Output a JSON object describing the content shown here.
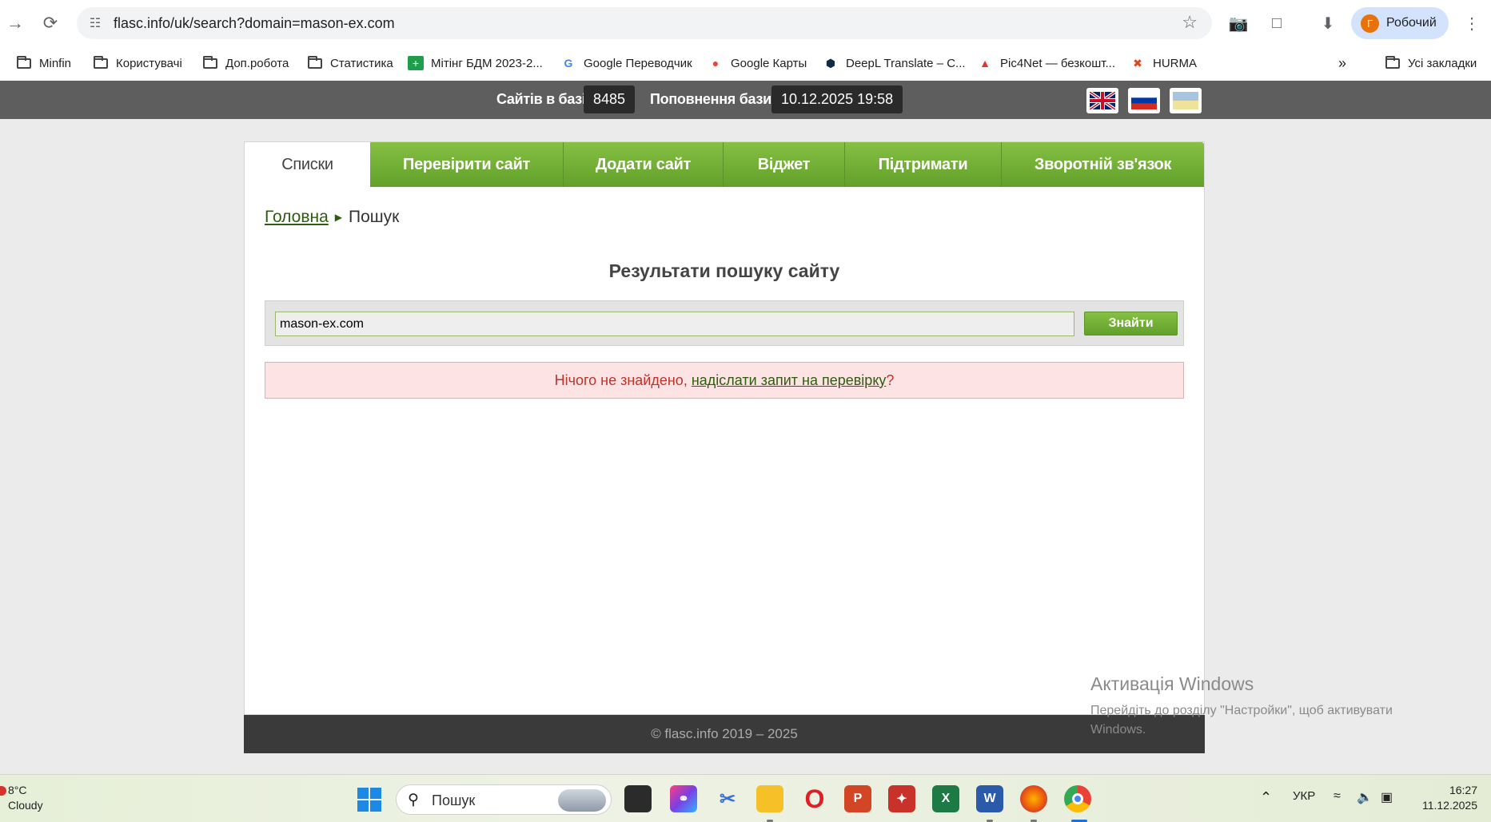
{
  "browser": {
    "url": "flasc.info/uk/search?domain=mason-ex.com",
    "profile_initial": "Г",
    "profile_name": "Робочий",
    "bookmarks": [
      {
        "label": "Minfin",
        "icon": "folder-icon"
      },
      {
        "label": "Користувачі",
        "icon": "folder-icon"
      },
      {
        "label": "Доп.робота",
        "icon": "folder-icon"
      },
      {
        "label": "Статистика",
        "icon": "folder-icon"
      },
      {
        "label": "Мітінг БДМ 2023-2...",
        "icon": "sheets-icon"
      },
      {
        "label": "Google Переводчик",
        "icon": "google-translate-icon"
      },
      {
        "label": "Google Карты",
        "icon": "google-maps-icon"
      },
      {
        "label": "DeepL Translate – C...",
        "icon": "deepl-icon"
      },
      {
        "label": "Pic4Net — безкошт...",
        "icon": "pic4net-icon"
      },
      {
        "label": "HURMA",
        "icon": "hurma-icon"
      }
    ],
    "more_bookmarks": "»",
    "all_bookmarks": "Усі закладки"
  },
  "site": {
    "stats": {
      "sites_label": "Сайтів в базі",
      "sites_count": "8485",
      "update_label": "Поповнення бази",
      "update_date": "10.12.2025 19:58"
    },
    "tabs": [
      {
        "label": "Списки"
      },
      {
        "label": "Перевірити сайт"
      },
      {
        "label": "Додати сайт"
      },
      {
        "label": "Віджет"
      },
      {
        "label": "Підтримати"
      },
      {
        "label": "Зворотній зв'язок"
      }
    ],
    "breadcrumb": {
      "home": "Головна",
      "current": "Пошук"
    },
    "results_title": "Результати пошуку сайту",
    "search": {
      "value": "mason-ex.com",
      "button": "Знайти"
    },
    "notfound": {
      "text": "Нічого не знайдено, ",
      "link": "надіслати запит на перевірку",
      "suffix": "?"
    },
    "footer": "© flasc.info 2019 – 2025"
  },
  "watermark": {
    "title": "Активація Windows",
    "text": "Перейдіть до розділу \"Настройки\", щоб активувати Windows."
  },
  "taskbar": {
    "weather_temp": "8°C",
    "weather_desc": "Cloudy",
    "search_label": "Пошук",
    "lang": "УКР",
    "time": "16:27",
    "date": "11.12.2025"
  },
  "colors": {
    "accent_green": "#6aa832",
    "header_gray": "#5e5e5e",
    "error_red": "#c0332b"
  }
}
